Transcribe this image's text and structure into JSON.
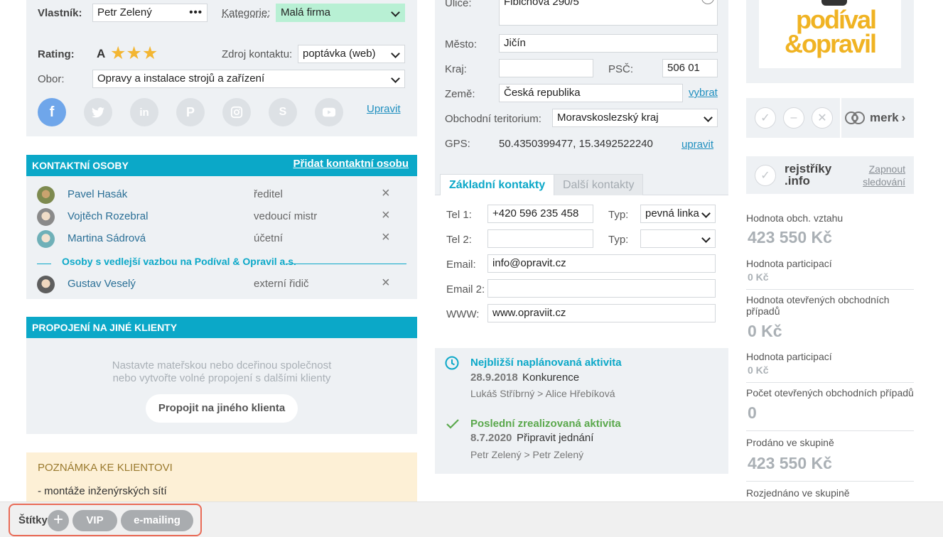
{
  "client": {
    "owner_label": "Vlastník:",
    "owner_value": "Petr Zelený",
    "category_label": "Kategorie:",
    "category_value": "Malá firma",
    "rating_label": "Rating:",
    "rating_value": "A",
    "rating_stars": 3,
    "source_label": "Zdroj kontaktu:",
    "source_value": "poptávka (web)",
    "field_label": "Obor:",
    "field_value": "Opravy a instalace strojů a zařízení",
    "social_edit": "Upravit"
  },
  "contacts_section": {
    "title": "KONTAKTNÍ OSOBY",
    "add_link": "Přidat kontaktní osobu",
    "people": [
      {
        "name": "Pavel Hasák",
        "role": "ředitel"
      },
      {
        "name": "Vojtěch Rozebral",
        "role": "vedoucí mistr"
      },
      {
        "name": "Martina Sádrová",
        "role": "účetní"
      }
    ],
    "secondary_heading": "Osoby s vedlejší vazbou na Podíval & Opravil a.s.",
    "secondary_people": [
      {
        "name": "Gustav Veselý",
        "role": "externí řidič"
      }
    ],
    "remove_glyph": "×"
  },
  "linking_section": {
    "title": "PROPOJENÍ NA JINÉ KLIENTY",
    "hint_line1": "Nastavte mateřskou nebo dceřinou společnost",
    "hint_line2": "nebo vytvořte volné propojení s dalšími klienty",
    "button": "Propojit na jiného klienta"
  },
  "note_section": {
    "title": "POZNÁMKA KE KLIENTOVI",
    "line1": "- montáže inženýrských sítí"
  },
  "address": {
    "street_label": "Ulice:",
    "street_value": "Fibichova 290/5",
    "city_label": "Město:",
    "city_value": "Jičín",
    "region_label": "Kraj:",
    "region_value": "",
    "zip_label": "PSČ:",
    "zip_value": "506 01",
    "country_label": "Země:",
    "country_value": "Česká republika",
    "country_pick": "vybrat",
    "territory_label": "Obchodní teritorium:",
    "territory_value": "Moravskoslezský kraj",
    "gps_label": "GPS:",
    "gps_value": "50.4350399477, 15.3492522240",
    "gps_edit": "upravit"
  },
  "contact_tabs": {
    "tab_basic": "Základní kontakty",
    "tab_more": "Další kontakty",
    "tel1_label": "Tel 1:",
    "tel1_value": "+420 596 235 458",
    "type_label": "Typ:",
    "type1_value": "pevná linka",
    "tel2_label": "Tel 2:",
    "tel2_value": "",
    "type2_value": "",
    "email_label": "Email:",
    "email_value": "info@opravit.cz",
    "email2_label": "Email 2:",
    "email2_value": "",
    "www_label": "WWW:",
    "www_value": "www.opraviit.cz"
  },
  "activities": {
    "next_title": "Nejbližší naplánovaná aktivita",
    "next_date": "28.9.2018",
    "next_name": "Konkurence",
    "next_people": "Lukáš Stříbrný > Alice Hřebíková",
    "last_title": "Poslední zrealizovaná aktivita",
    "last_date": "8.7.2020",
    "last_name": "Připravit jednání",
    "last_people": "Petr Zelený > Petr Zelený"
  },
  "right_panel": {
    "logo_line1": "podíval",
    "logo_line2": "&opravil",
    "merk_label": "merk",
    "rejstriky_line1": "rejstříky",
    "rejstriky_line2": ".info",
    "follow_line1": "Zapnout",
    "follow_line2": "sledování",
    "stats": [
      {
        "label": "Hodnota obch. vztahu",
        "value": "423 550 Kč"
      },
      {
        "label": "Hodnota participací",
        "value": "0 Kč"
      },
      {
        "label": "Hodnota otevřených obchodních případů",
        "value": "0 Kč"
      },
      {
        "label": "Hodnota participací",
        "value": "0 Kč"
      },
      {
        "label": "Počet otevřených obchodních případů",
        "value": "0"
      },
      {
        "label": "Prodáno ve skupině",
        "value": "423 550 Kč"
      },
      {
        "label": "Rozjednáno ve skupině",
        "value": ""
      }
    ]
  },
  "tags": {
    "label": "Štítky",
    "add": "+",
    "items": [
      "VIP",
      "e-mailing"
    ]
  },
  "colors": {
    "accent": "#0ba8c8",
    "category_bg": "#b8f0d4",
    "star": "#f3b632",
    "highlight_border": "#e96b57",
    "green_check": "#5aa84c"
  }
}
